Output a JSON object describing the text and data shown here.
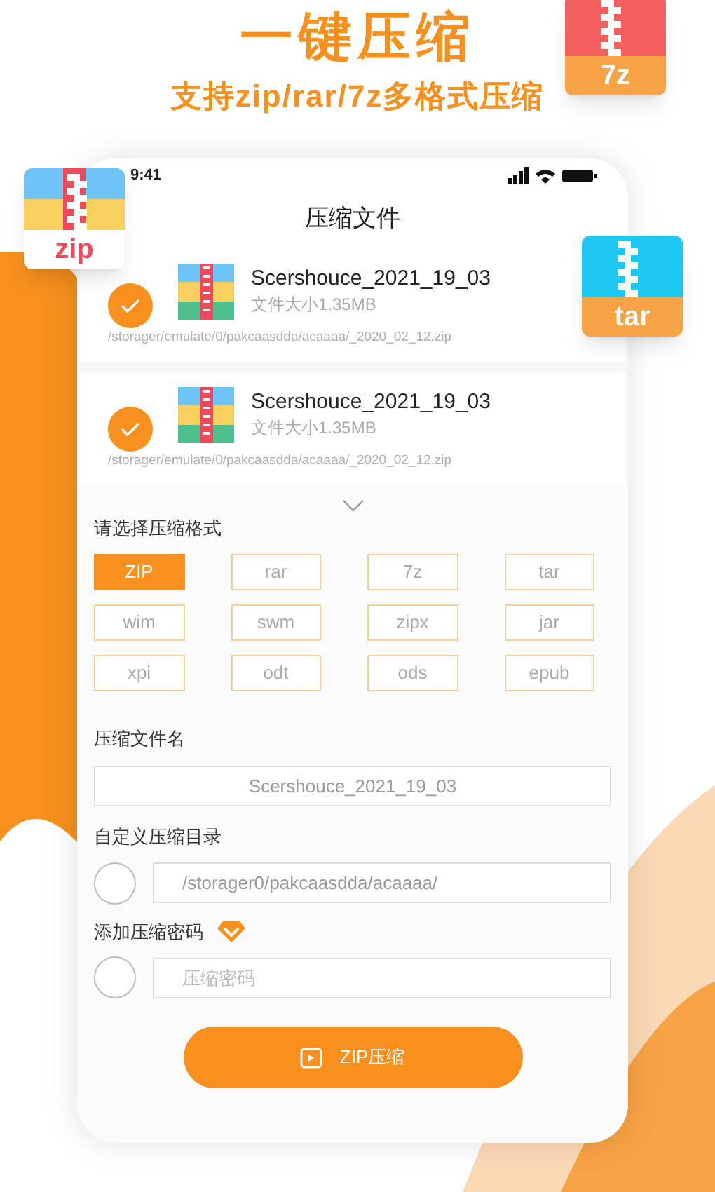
{
  "headline": "一键压缩",
  "subtitle": "支持zip/rar/7z多格式压缩",
  "badges": [
    {
      "kind": "sevenz",
      "label": "7z"
    },
    {
      "kind": "zip",
      "label": "zip"
    },
    {
      "kind": "tar",
      "label": "tar"
    }
  ],
  "status_bar": {
    "time": "9:41"
  },
  "title": "压缩文件",
  "files": [
    {
      "name": "Scershouce_2021_19_03",
      "size": "文件大小1.35MB",
      "path": "/storager/emulate/0/pakcaasdda/acaaaa/_2020_02_12.zip",
      "checked": true
    },
    {
      "name": "Scershouce_2021_19_03",
      "size": "文件大小1.35MB",
      "path": "/storager/emulate/0/pakcaasdda/acaaaa/_2020_02_12.zip",
      "checked": true
    }
  ],
  "format_section": {
    "label": "请选择压缩格式",
    "formats": [
      {
        "label": "ZIP",
        "selected": true
      },
      {
        "label": "rar",
        "selected": false
      },
      {
        "label": "7z",
        "selected": false
      },
      {
        "label": "tar",
        "selected": false
      },
      {
        "label": "wim",
        "selected": false
      },
      {
        "label": "swm",
        "selected": false
      },
      {
        "label": "zipx",
        "selected": false
      },
      {
        "label": "jar",
        "selected": false
      },
      {
        "label": "xpi",
        "selected": false
      },
      {
        "label": "odt",
        "selected": false
      },
      {
        "label": "ods",
        "selected": false
      },
      {
        "label": "epub",
        "selected": false
      }
    ]
  },
  "filename": {
    "label": "压缩文件名",
    "value": "Scershouce_2021_19_03"
  },
  "directory": {
    "label": "自定义压缩目录",
    "checked": false,
    "value": "/storager0/pakcaasdda/acaaaa/"
  },
  "password": {
    "label": "添加压缩密码",
    "checked": false,
    "placeholder": "压缩密码"
  },
  "action_button": "ZIP压缩"
}
